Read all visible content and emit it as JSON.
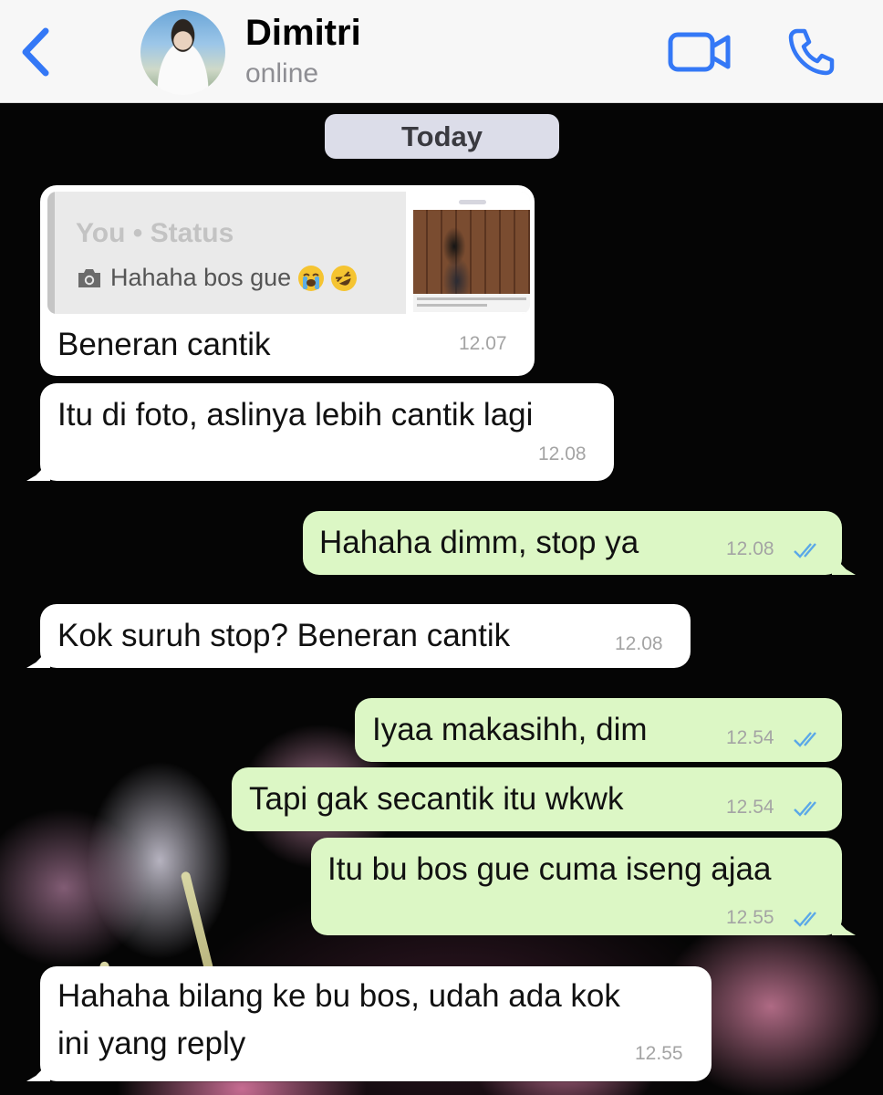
{
  "header": {
    "contact_name": "Dimitri",
    "contact_status": "online",
    "accent_color": "#3478f6"
  },
  "date_separator": "Today",
  "reply_quote": {
    "label": "You • Status",
    "preview_text": "Hahaha bos gue",
    "preview_emojis": [
      "loudly-crying-face-icon",
      "rolling-on-floor-laughing-icon"
    ]
  },
  "messages": [
    {
      "direction": "incoming",
      "text": "Beneran cantik",
      "time": "12.07"
    },
    {
      "direction": "incoming",
      "text": "Itu di foto, aslinya lebih cantik lagi",
      "time": "12.08"
    },
    {
      "direction": "outgoing",
      "text": "Hahaha dimm, stop ya",
      "time": "12.08",
      "read": true
    },
    {
      "direction": "incoming",
      "text": "Kok suruh stop? Beneran cantik",
      "time": "12.08"
    },
    {
      "direction": "outgoing",
      "text": "Iyaa makasihh, dim",
      "time": "12.54",
      "read": true
    },
    {
      "direction": "outgoing",
      "text": "Tapi gak secantik itu wkwk",
      "time": "12.54",
      "read": true
    },
    {
      "direction": "outgoing",
      "text": "Itu bu bos gue cuma iseng ajaa",
      "time": "12.55",
      "read": true
    },
    {
      "direction": "incoming",
      "text_lines": [
        "Hahaha bilang ke bu bos, udah ada kok",
        "ini yang reply"
      ],
      "time": "12.55"
    }
  ],
  "colors": {
    "incoming_bubble": "#ffffff",
    "outgoing_bubble": "#dcf7c5",
    "read_ticks": "#5aa8e8"
  }
}
